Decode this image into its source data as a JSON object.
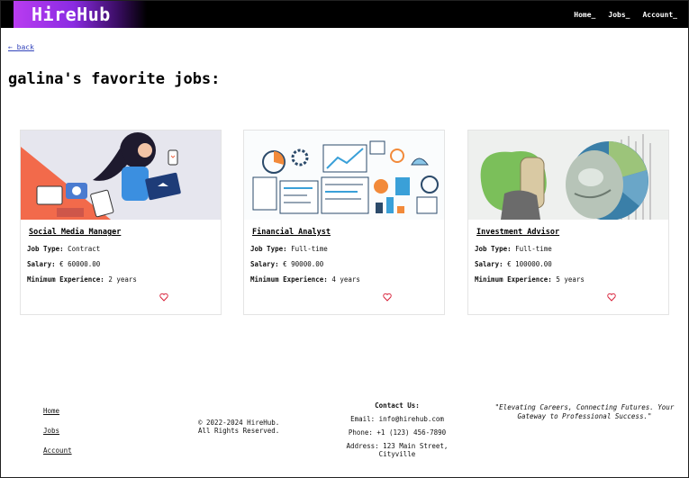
{
  "header": {
    "logo": "HireHub",
    "nav": [
      {
        "label": "Home_"
      },
      {
        "label": "Jobs_"
      },
      {
        "label": "Account_"
      }
    ]
  },
  "back_link": "← back",
  "page_title": "galina's favorite jobs:",
  "labels": {
    "job_type": "Job Type:",
    "salary": "Salary:",
    "experience": "Minimum Experience:"
  },
  "jobs": [
    {
      "title": "Social Media Manager",
      "job_type": "Contract",
      "salary": "€ 60000.00",
      "experience": "2 years",
      "image_icon": "social-media-illustration",
      "favorited": true
    },
    {
      "title": "Financial Analyst",
      "job_type": "Full-time",
      "salary": "€ 90000.00",
      "experience": "4 years",
      "image_icon": "finance-infographic-illustration",
      "favorited": true
    },
    {
      "title": "Investment Advisor",
      "job_type": "Full-time",
      "salary": "€ 100000.00",
      "experience": "5 years",
      "image_icon": "banknote-pie-chart-illustration",
      "favorited": true
    }
  ],
  "footer": {
    "links": [
      {
        "label": "Home"
      },
      {
        "label": "Jobs"
      },
      {
        "label": "Account"
      }
    ],
    "copyright_line1": "© 2022-2024 HireHub.",
    "copyright_line2": "All Rights Reserved.",
    "contact_heading": "Contact Us:",
    "email": "Email: info@hirehub.com",
    "phone": "Phone: +1 (123) 456-7890",
    "address": "Address: 123 Main Street, Cityville",
    "tagline": "\"Elevating Careers, Connecting Futures. Your Gateway to Professional Success.\""
  },
  "colors": {
    "accent": "#8a2be2",
    "heart": "#d9243c",
    "link": "#3344bb"
  }
}
